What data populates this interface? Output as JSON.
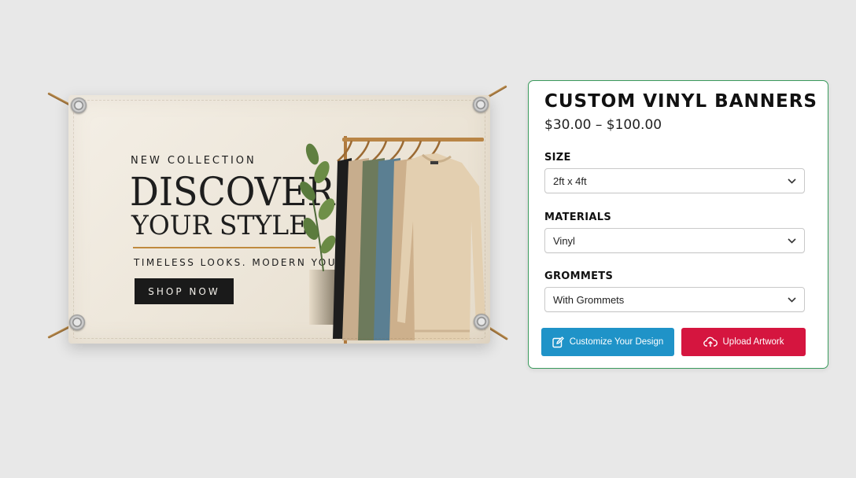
{
  "banner": {
    "kicker": "NEW COLLECTION",
    "headline_line1": "DISCOVER",
    "headline_line2": "YOUR STYLE",
    "tagline": "TIMELESS LOOKS. MODERN YOU.",
    "cta_label": "SHOP NOW",
    "icons": [
      "grommet",
      "clothing-rack",
      "plant"
    ]
  },
  "product": {
    "title": "CUSTOM VINYL BANNERS",
    "price_range": "$30.00 – $100.00",
    "options": {
      "size": {
        "label": "SIZE",
        "value": "2ft x 4ft"
      },
      "materials": {
        "label": "MATERIALS",
        "value": "Vinyl"
      },
      "grommets": {
        "label": "GROMMETS",
        "value": "With Grommets"
      }
    },
    "buttons": {
      "customize": {
        "label": "Customize Your Design",
        "icon": "edit-icon",
        "color": "#1f93c8"
      },
      "upload": {
        "label": "Upload Artwork",
        "icon": "cloud-upload-icon",
        "color": "#d5153f"
      }
    },
    "accent_border": "#3a9a5c"
  }
}
